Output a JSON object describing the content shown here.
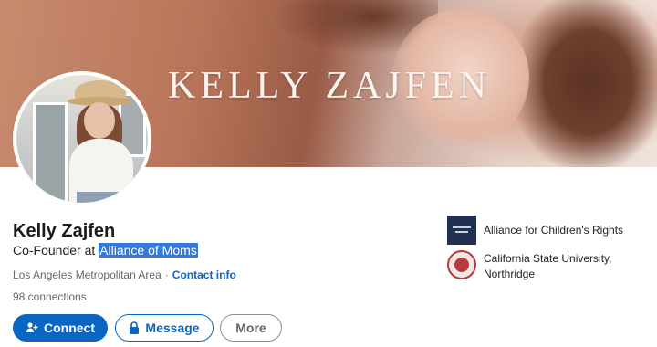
{
  "banner": {
    "title": "KELLY ZAJFEN"
  },
  "profile": {
    "name": "Kelly Zajfen",
    "headline_prefix": "Co-Founder at ",
    "headline_company": "Alliance of Moms",
    "location": "Los Angeles Metropolitan Area",
    "separator": "·",
    "contact_info": "Contact info",
    "connections": "98 connections"
  },
  "actions": {
    "connect": "Connect",
    "message": "Message",
    "more": "More"
  },
  "sidebar": {
    "experience": "Alliance for Children's Rights",
    "education_line1": "California State University,",
    "education_line2": "Northridge"
  },
  "colors": {
    "primary": "#0a66c2",
    "highlight": "#3478d8"
  }
}
